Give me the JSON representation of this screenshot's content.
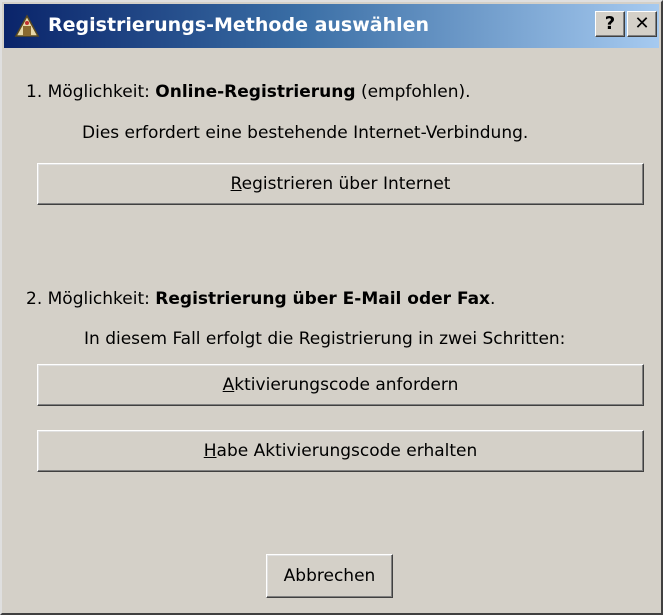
{
  "window": {
    "title": "Registrierungs-Methode auswählen",
    "help_button": "?",
    "close_button": "✕"
  },
  "option1": {
    "prefix": "1. Möglichkeit: ",
    "bold": "Online-Registrierung",
    "suffix": " (empfohlen).",
    "note": "Dies erfordert eine bestehende Internet-Verbindung.",
    "button": {
      "mnemonic": "R",
      "rest": "egistrieren über Internet"
    }
  },
  "option2": {
    "prefix": "2. Möglichkeit: ",
    "bold": "Registrierung über E-Mail oder Fax",
    "suffix": ".",
    "note": "In diesem Fall erfolgt die Registrierung in zwei Schritten:",
    "button_request": {
      "mnemonic": "A",
      "rest": "ktivierungscode anfordern"
    },
    "button_received": {
      "mnemonic": "H",
      "rest": "abe Aktivierungscode erhalten"
    }
  },
  "cancel_button": "Abbrechen",
  "colors": {
    "titlebar_start": "#0a246a",
    "titlebar_end": "#a6caf0",
    "face": "#d4d0c8"
  }
}
